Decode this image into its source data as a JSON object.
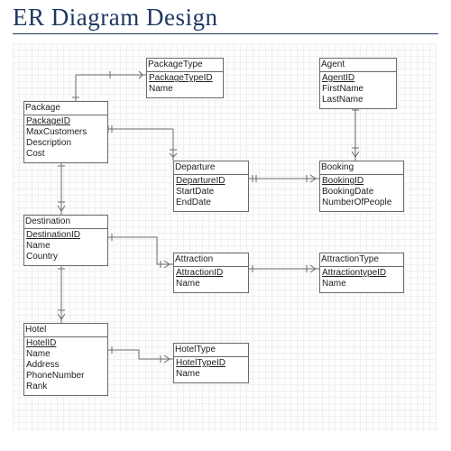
{
  "title": "ER Diagram Design",
  "entities": {
    "packagetype": {
      "name": "PackageType",
      "pk": "PackageTypeID",
      "attrs": [
        "Name"
      ]
    },
    "agent": {
      "name": "Agent",
      "pk": "AgentID",
      "attrs": [
        "FirstName",
        "LastName"
      ]
    },
    "package": {
      "name": "Package",
      "pk": "PackageID",
      "attrs": [
        "MaxCustomers",
        "Description",
        "Cost"
      ]
    },
    "departure": {
      "name": "Departure",
      "pk": "DepartureID",
      "attrs": [
        "StartDate",
        "EndDate"
      ]
    },
    "booking": {
      "name": "Booking",
      "pk": "BookingID",
      "attrs": [
        "BookingDate",
        "NumberOfPeople"
      ]
    },
    "destination": {
      "name": "Destination",
      "pk": "DestinationID",
      "attrs": [
        "Name",
        "Country"
      ]
    },
    "attraction": {
      "name": "Attraction",
      "pk": "AttractionID",
      "attrs": [
        "Name"
      ]
    },
    "attractiontype": {
      "name": "AttractionType",
      "pk": "AttractiontypeID",
      "attrs": [
        "Name"
      ]
    },
    "hotel": {
      "name": "Hotel",
      "pk": "HotelID",
      "attrs": [
        "Name",
        "Address",
        "PhoneNumber",
        "Rank"
      ]
    },
    "hoteltype": {
      "name": "HotelType",
      "pk": "HotelTypeID",
      "attrs": [
        "Name"
      ]
    }
  }
}
